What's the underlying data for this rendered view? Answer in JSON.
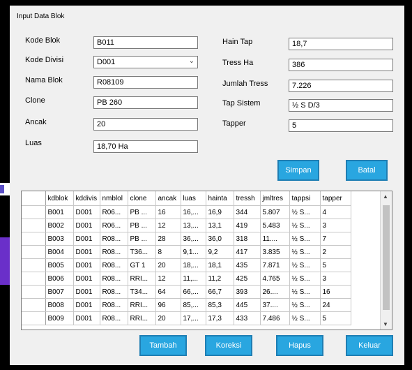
{
  "window": {
    "title": "Input Data Blok"
  },
  "form": {
    "kode_blok": {
      "label": "Kode Blok",
      "value": "B011"
    },
    "kode_divisi": {
      "label": "Kode Divisi",
      "value": "D001"
    },
    "nama_blok": {
      "label": "Nama Blok",
      "value": "R08109"
    },
    "clone": {
      "label": "Clone",
      "value": "PB 260"
    },
    "ancak": {
      "label": "Ancak",
      "value": "20"
    },
    "luas": {
      "label": "Luas",
      "value": "18,70 Ha"
    },
    "hain_tap": {
      "label": "Hain Tap",
      "value": "18,7"
    },
    "tress_ha": {
      "label": "Tress Ha",
      "value": "386"
    },
    "jumlah_tress": {
      "label": "Jumlah Tress",
      "value": "7.226"
    },
    "tap_sistem": {
      "label": "Tap Sistem",
      "value": "½ S D/3"
    },
    "tapper": {
      "label": "Tapper",
      "value": "5"
    }
  },
  "buttons": {
    "simpan": "Simpan",
    "batal": "Batal",
    "tambah": "Tambah",
    "koreksi": "Koreksi",
    "hapus": "Hapus",
    "keluar": "Keluar"
  },
  "table": {
    "columns": [
      "kdblok",
      "kddivis",
      "nmblol",
      "clone",
      "ancak",
      "luas",
      "hainta",
      "tressh",
      "jmltres",
      "tappsi",
      "tapper"
    ],
    "rows": [
      [
        "B001",
        "D001",
        "R06...",
        "PB ...",
        "16",
        "16,...",
        "16,9",
        "344",
        "5.807",
        "½ S...",
        "4"
      ],
      [
        "B002",
        "D001",
        "R06...",
        "PB ...",
        "12",
        "13,...",
        "13,1",
        "419",
        "5.483",
        "½ S...",
        "3"
      ],
      [
        "B003",
        "D001",
        "R08...",
        "PB ...",
        "28",
        "36,...",
        "36,0",
        "318",
        "11....",
        "½ S...",
        "7"
      ],
      [
        "B004",
        "D001",
        "R08...",
        "T36...",
        "8",
        "9,1...",
        "9,2",
        "417",
        "3.835",
        "½ S...",
        "2"
      ],
      [
        "B005",
        "D001",
        "R08...",
        "GT 1",
        "20",
        "18,...",
        "18,1",
        "435",
        "7.871",
        "½ S...",
        "5"
      ],
      [
        "B006",
        "D001",
        "R08...",
        "RRI...",
        "12",
        "11,...",
        "11,2",
        "425",
        "4.765",
        "½ S...",
        "3"
      ],
      [
        "B007",
        "D001",
        "R08...",
        "T34...",
        "64",
        "66,...",
        "66,7",
        "393",
        "26....",
        "½ S...",
        "16"
      ],
      [
        "B008",
        "D001",
        "R08...",
        "RRI...",
        "96",
        "85,...",
        "85,3",
        "445",
        "37....",
        "½ S...",
        "24"
      ],
      [
        "B009",
        "D001",
        "R08...",
        "RRI...",
        "20",
        "17,...",
        "17,3",
        "433",
        "7.486",
        "½ S...",
        "5"
      ]
    ]
  },
  "icons": {
    "dropdown": "chevron-down-icon",
    "scroll_up": "scroll-up-icon",
    "scroll_down": "scroll-down-icon"
  },
  "colors": {
    "button_bg": "#29a6e0",
    "window_bg": "#f0f0f0"
  }
}
